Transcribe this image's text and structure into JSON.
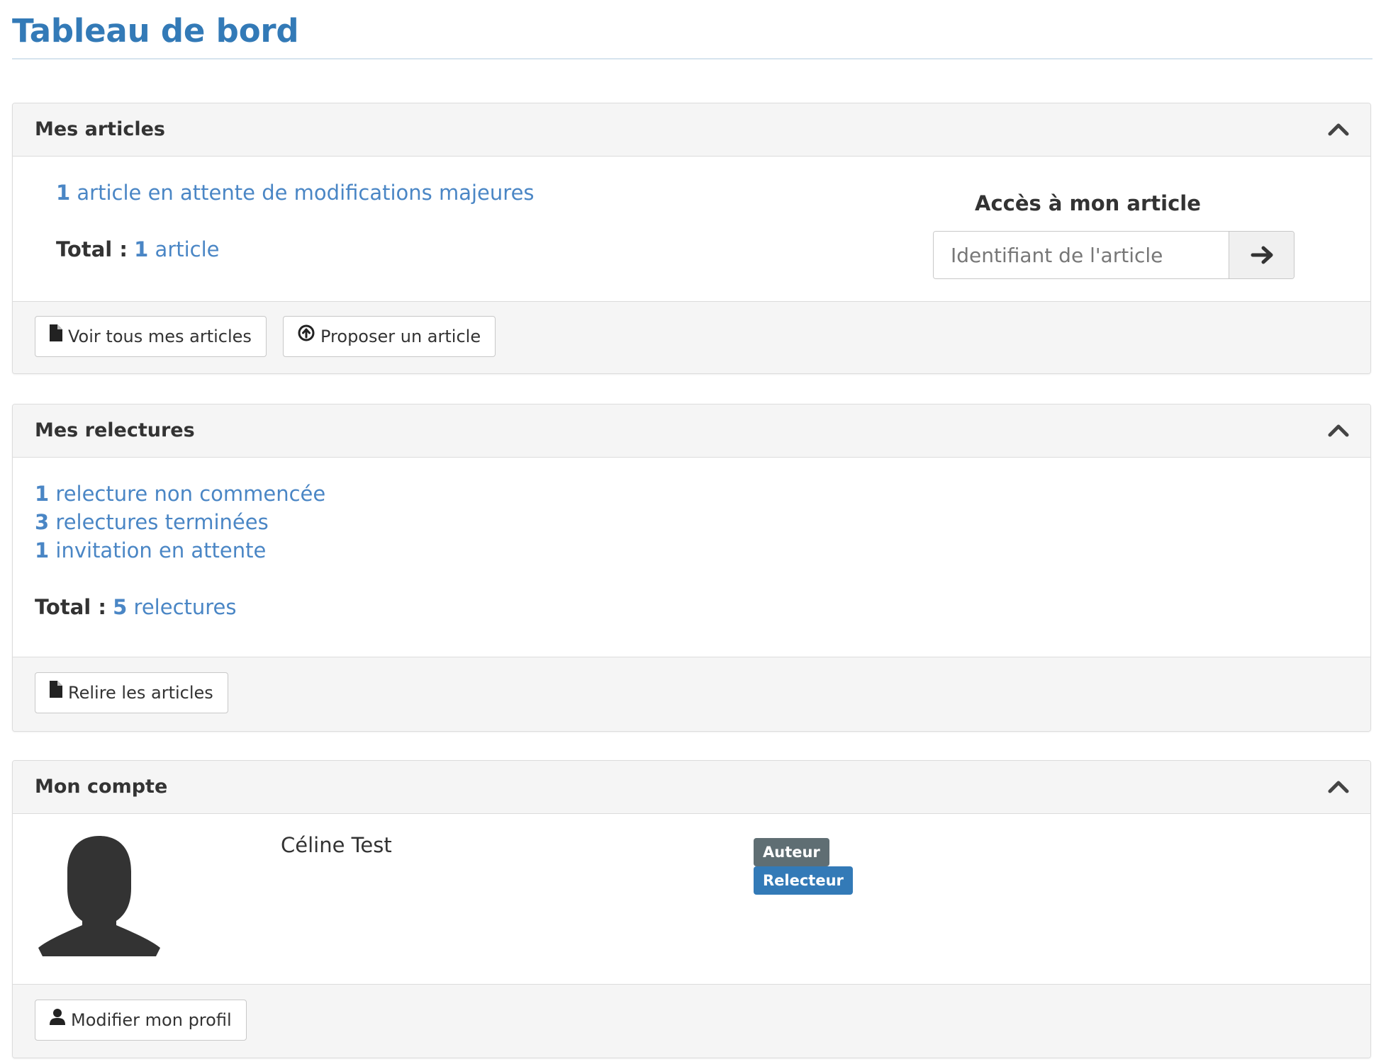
{
  "page": {
    "title": "Tableau de bord"
  },
  "articles_panel": {
    "title": "Mes articles",
    "stat": {
      "count": "1",
      "text": "article en attente de modifications majeures"
    },
    "total": {
      "label": "Total :",
      "count": "1",
      "unit": "article"
    },
    "access": {
      "title": "Accès à mon article",
      "placeholder": "Identifiant de l'article"
    },
    "buttons": {
      "view_all": "Voir tous mes articles",
      "propose": "Proposer un article"
    }
  },
  "reviews_panel": {
    "title": "Mes relectures",
    "stats": [
      {
        "count": "1",
        "text": "relecture non commencée"
      },
      {
        "count": "3",
        "text": "relectures terminées"
      },
      {
        "count": "1",
        "text": "invitation en attente"
      }
    ],
    "total": {
      "label": "Total :",
      "count": "5",
      "unit": "relectures"
    },
    "buttons": {
      "review": "Relire les articles"
    }
  },
  "account_panel": {
    "title": "Mon compte",
    "user_name": "Céline Test",
    "roles": [
      {
        "label": "Auteur",
        "color": "#5f6e73"
      },
      {
        "label": "Relecteur",
        "color": "#337ab7"
      }
    ],
    "buttons": {
      "edit_profile": "Modifier mon profil"
    }
  },
  "icons": {
    "collapse": "chevron-up-icon",
    "file": "file-icon",
    "upload": "upload-circle-icon",
    "arrow": "arrow-right-icon",
    "user": "user-icon",
    "avatar": "avatar-placeholder"
  }
}
